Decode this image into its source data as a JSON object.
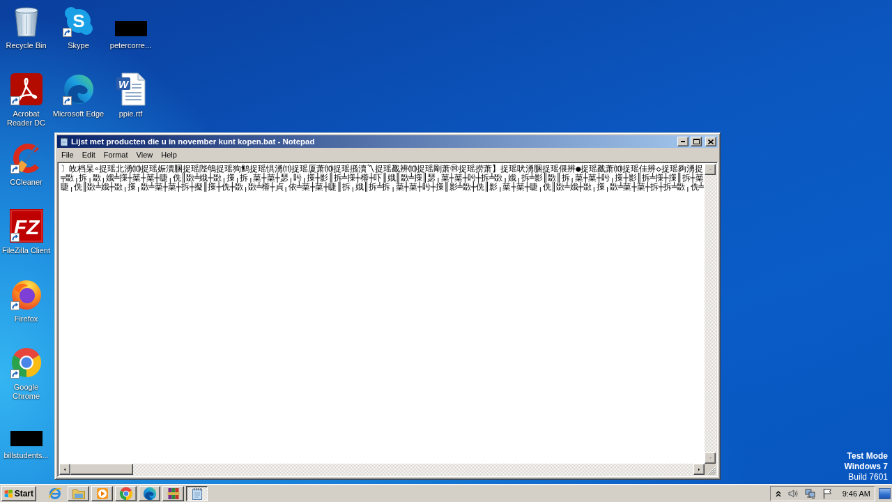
{
  "desktop": {
    "columns": [
      [
        {
          "label": "Recycle Bin",
          "kind": "recycle_bin",
          "shortcut": false
        },
        {
          "label": "Acrobat Reader DC",
          "kind": "acrobat",
          "shortcut": true
        },
        {
          "label": "CCleaner",
          "kind": "ccleaner",
          "shortcut": true
        },
        {
          "label": "FileZilla Client",
          "kind": "filezilla",
          "shortcut": true,
          "logo_text": "FZ"
        },
        {
          "label": "Firefox",
          "kind": "firefox",
          "shortcut": true
        },
        {
          "label": "Google Chrome",
          "kind": "chrome",
          "shortcut": true
        },
        {
          "label": "billstudents...",
          "kind": "redacted",
          "shortcut": false
        }
      ],
      [
        {
          "label": "Skype",
          "kind": "skype",
          "shortcut": true,
          "logo_text": "S"
        },
        {
          "label": "Microsoft Edge",
          "kind": "edge",
          "shortcut": true
        }
      ],
      [
        {
          "label": "petercorre...",
          "kind": "redacted",
          "shortcut": false
        },
        {
          "label": "ppie.rtf",
          "kind": "word_document",
          "shortcut": false,
          "logo_text": "W"
        }
      ]
    ]
  },
  "notepad": {
    "title": "Lijst met producten die u in november kunt kopen.bat - Notepad",
    "menu": [
      "File",
      "Edit",
      "Format",
      "View",
      "Help"
    ],
    "lines": [
      "〕敀档杲∘捉瑶北湧⑽捉瑶娠瀆䐃捉瑶陛鵇捉瑶狗鹪捉瑶惧湧⑾捉瑶厦萧⑽捉瑶搎瀆〽捉瑶戤辨⑽捉瑶剛萧㉽捉瑶捞萧】捉瑶吠湧䐃捉瑶偎辨●捉瑶戤萧⑽捉瑶佳辨◇捉瑶夠湧捉",
      "╤敪╷拆╷敪╷娥╧㩍┼䔁┼䔁┼睫╷侁║敪╧娥┼敪╷㩍╷拆╷䔁┼䔁┼瑟╷盻╷㩍┼影║拆╧㩍┼㯴┼吓║娥║敪╧㩍║瑟╷䔁┼䔁┼盻┼拆╧敪╷娥╷拆╧影║敪║拆╷䔁┼䔁┼盻╷㩍┼影║拆╧㩍┼㩍║拆┼䔁",
      "睫╷侁║敪╧娥┼敪╷㩍╷敪╧䔁┼䔁┼拆┼擬║㩍┼侁┼敪╷敪╧㯴┼貞╷依╧䔁┼䔁┼睫║拆╷娥║拆╧拆╷䔁┼䔁┼盻┼㩍║影╧敪┼侁║影╷䔁┼䔁┼睫╷侁║敪╧娥┼敪╷㩍╷敪╧䔁┼䔁┼拆┼拆╧敪╷侁╧"
    ]
  },
  "os_notice": [
    {
      "text": "Test Mode",
      "bold": true
    },
    {
      "text": "Windows 7",
      "bold": true
    },
    {
      "text": "Build 7601",
      "bold": false
    }
  ],
  "taskbar": {
    "start": "Start",
    "quick_launch": [
      {
        "kind": "internet_explorer"
      }
    ],
    "tasks": [
      {
        "kind": "explorer",
        "selected": false
      },
      {
        "kind": "media_player",
        "selected": false
      },
      {
        "kind": "chrome",
        "selected": false
      },
      {
        "kind": "edge",
        "selected": false
      },
      {
        "kind": "winrar",
        "selected": false
      },
      {
        "kind": "notepad",
        "selected": true
      }
    ],
    "clock": "9:46 AM"
  }
}
